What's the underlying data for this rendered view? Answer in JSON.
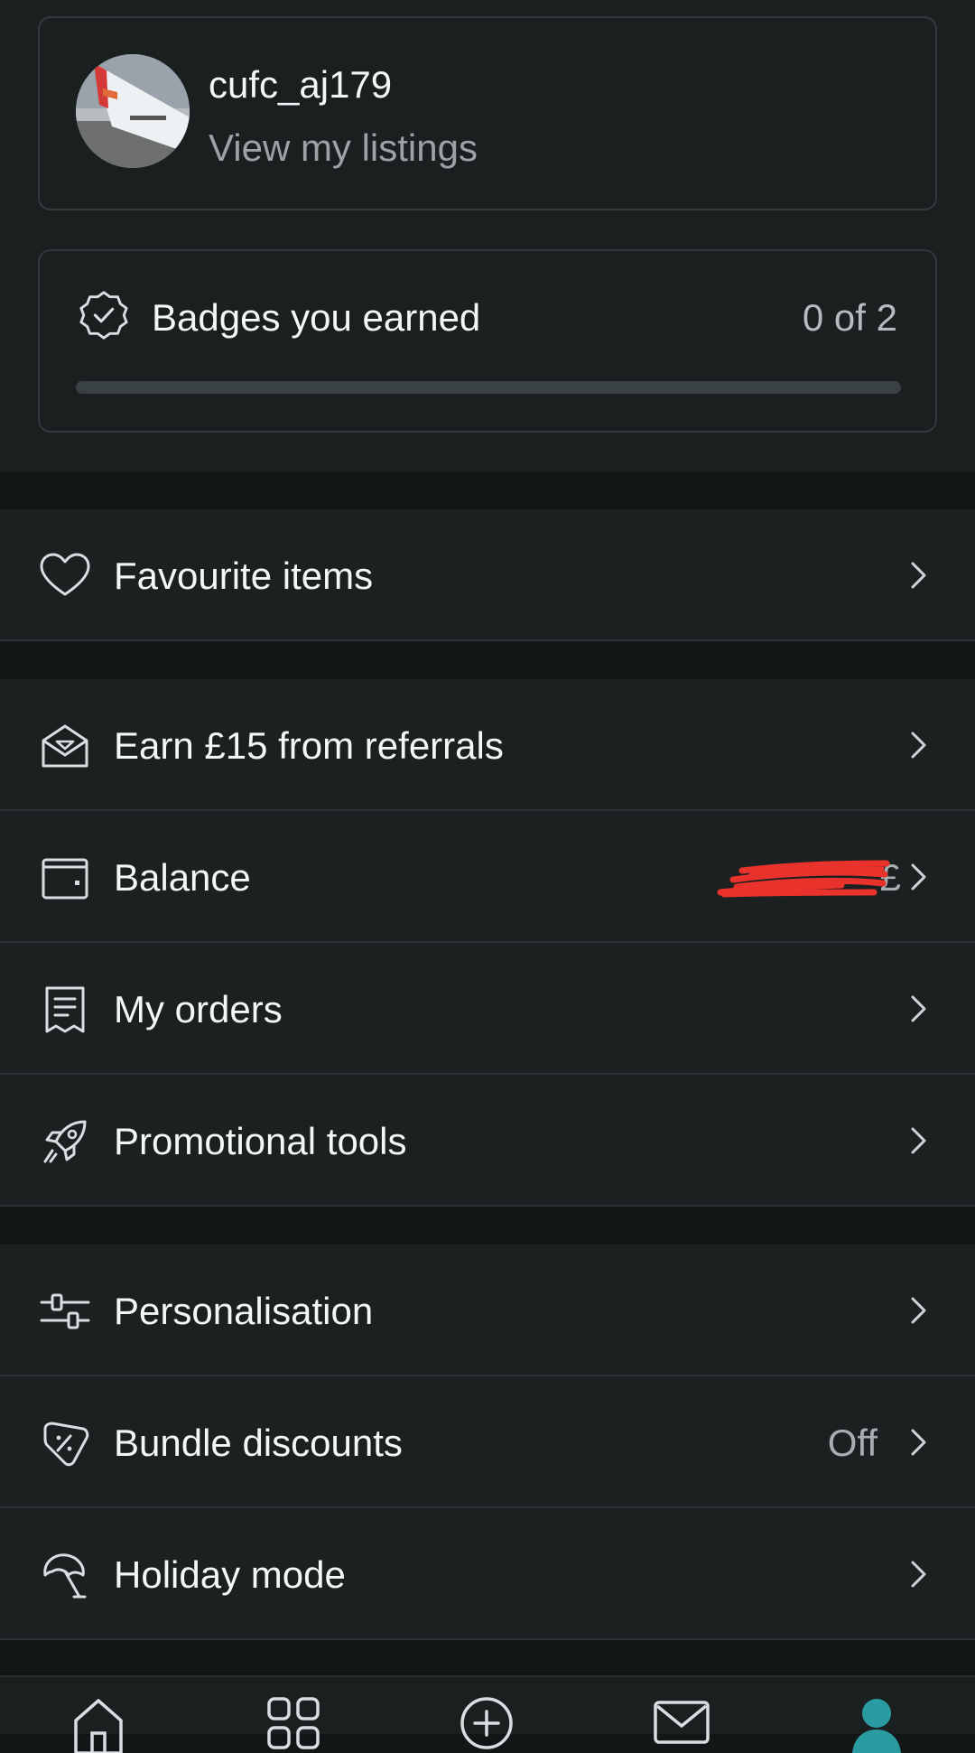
{
  "profile": {
    "username": "cufc_aj179",
    "subtitle": "View my listings",
    "avatar_icon": "airplane-wing-photo"
  },
  "badges": {
    "title": "Badges you earned",
    "count_text": "0 of 2",
    "earned": 0,
    "total": 2,
    "progress_fraction": 0,
    "icon": "badge-check-icon"
  },
  "menu": {
    "favourites": {
      "label": "Favourite items",
      "icon": "heart-icon"
    },
    "referrals": {
      "label": "Earn £15 from referrals",
      "icon": "envelope-open-icon"
    },
    "balance": {
      "label": "Balance",
      "value_prefix": "£",
      "value_redacted": true,
      "icon": "wallet-icon"
    },
    "orders": {
      "label": "My orders",
      "icon": "receipt-icon"
    },
    "promotional": {
      "label": "Promotional tools",
      "icon": "rocket-icon"
    },
    "personalisation": {
      "label": "Personalisation",
      "icon": "sliders-icon"
    },
    "bundle": {
      "label": "Bundle discounts",
      "value": "Off",
      "icon": "price-tag-icon"
    },
    "holiday": {
      "label": "Holiday mode",
      "icon": "umbrella-icon"
    }
  },
  "bottom_nav": {
    "items": [
      "home-icon",
      "catalog-grid-icon",
      "sell-plus-icon",
      "inbox-mail-icon",
      "profile-icon"
    ],
    "active": "profile-icon"
  },
  "colors": {
    "background": "#121617",
    "surface": "#1b2021",
    "accent": "#0c7a79",
    "text": "#f4f6f7",
    "muted": "#9ca3a6",
    "redaction": "#e8322b"
  }
}
